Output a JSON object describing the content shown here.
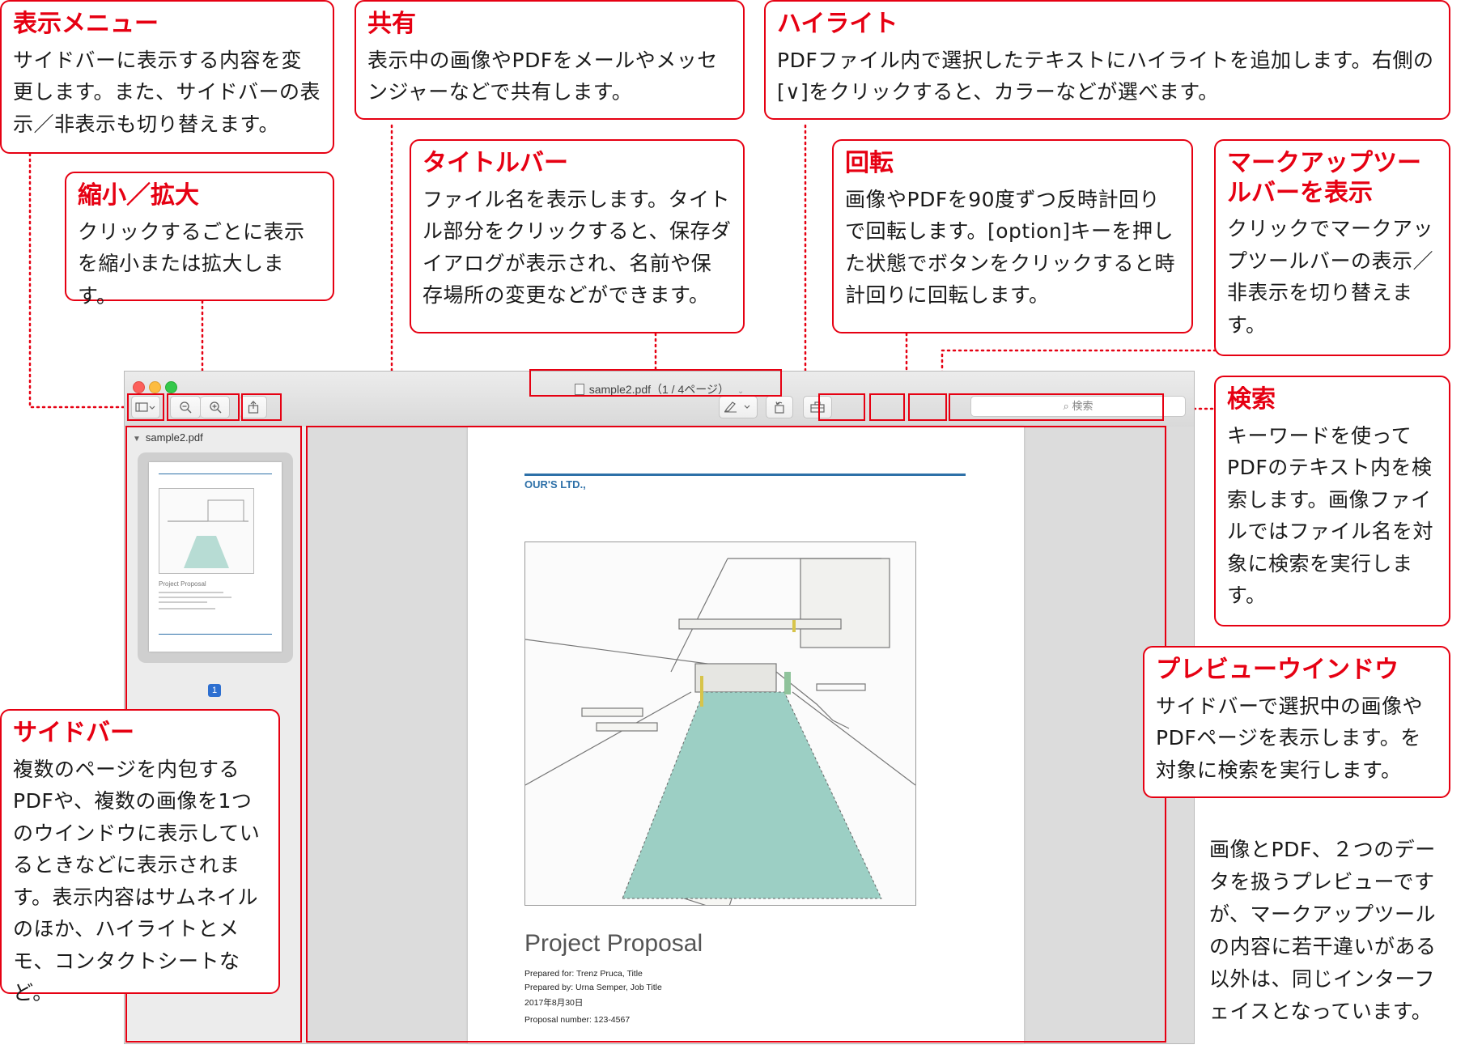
{
  "callouts": {
    "view_menu": {
      "title": "表示メニュー",
      "body": "サイドバーに表示する内容を変更します。また、サイドバーの表示／非表示も切り替えます。"
    },
    "share": {
      "title": "共有",
      "body": "表示中の画像やPDFをメールやメッセンジャーなどで共有します。"
    },
    "highlight": {
      "title": "ハイライト",
      "body": "PDFファイル内で選択したテキストにハイライトを追加します。右側の[∨]をクリックすると、カラーなどが選べます。"
    },
    "zoom": {
      "title": "縮小／拡大",
      "body": "クリックするごとに表示を縮小または拡大します。"
    },
    "titlebar": {
      "title": "タイトルバー",
      "body": "ファイル名を表示します。タイトル部分をクリックすると、保存ダイアログが表示され、名前や保存場所の変更などができます。"
    },
    "rotate": {
      "title": "回転",
      "body": "画像やPDFを90度ずつ反時計回りで回転します。[option]キーを押した状態でボタンをクリックすると時計回りに回転します。"
    },
    "markup": {
      "title": "マークアップツールバーを表示",
      "body": "クリックでマークアップツールバーの表示／非表示を切り替えます。"
    },
    "search": {
      "title": "検索",
      "body": "キーワードを使ってPDFのテキスト内を検索します。画像ファイルではファイル名を対象に検索を実行します。"
    },
    "preview_window": {
      "title": "プレビューウインドウ",
      "body": "サイドバーで選択中の画像やPDFページを表示します。を対象に検索を実行します。"
    },
    "sidebar": {
      "title": "サイドバー",
      "body": "複数のページを内包するPDFや、複数の画像を1つのウインドウに表示しているときなどに表示されます。表示内容はサムネイルのほか、ハイライトとメモ、コンタクトシートなど。"
    }
  },
  "footnote": "画像とPDF、２つのデータを扱うプレビューですが、マークアップツールの内容に若干違いがある以外は、同じインターフェイスとなっています。",
  "window": {
    "title": "sample2.pdf（1 / 4ページ）",
    "search_placeholder": "検索",
    "sidebar_header": "sample2.pdf",
    "page_badge": "1"
  },
  "document": {
    "company": "OUR'S LTD.,",
    "title": "Project Proposal",
    "prepared_for": "Prepared for: Trenz Pruca, Title",
    "prepared_by": "Prepared by: Urna Semper, Job Title",
    "date": "2017年8月30日",
    "proposal_number": "Proposal number: 123-4567"
  },
  "colors": {
    "accent": "#e60012",
    "doc_blue": "#2d70a8",
    "pool": "#9ccfc4"
  }
}
